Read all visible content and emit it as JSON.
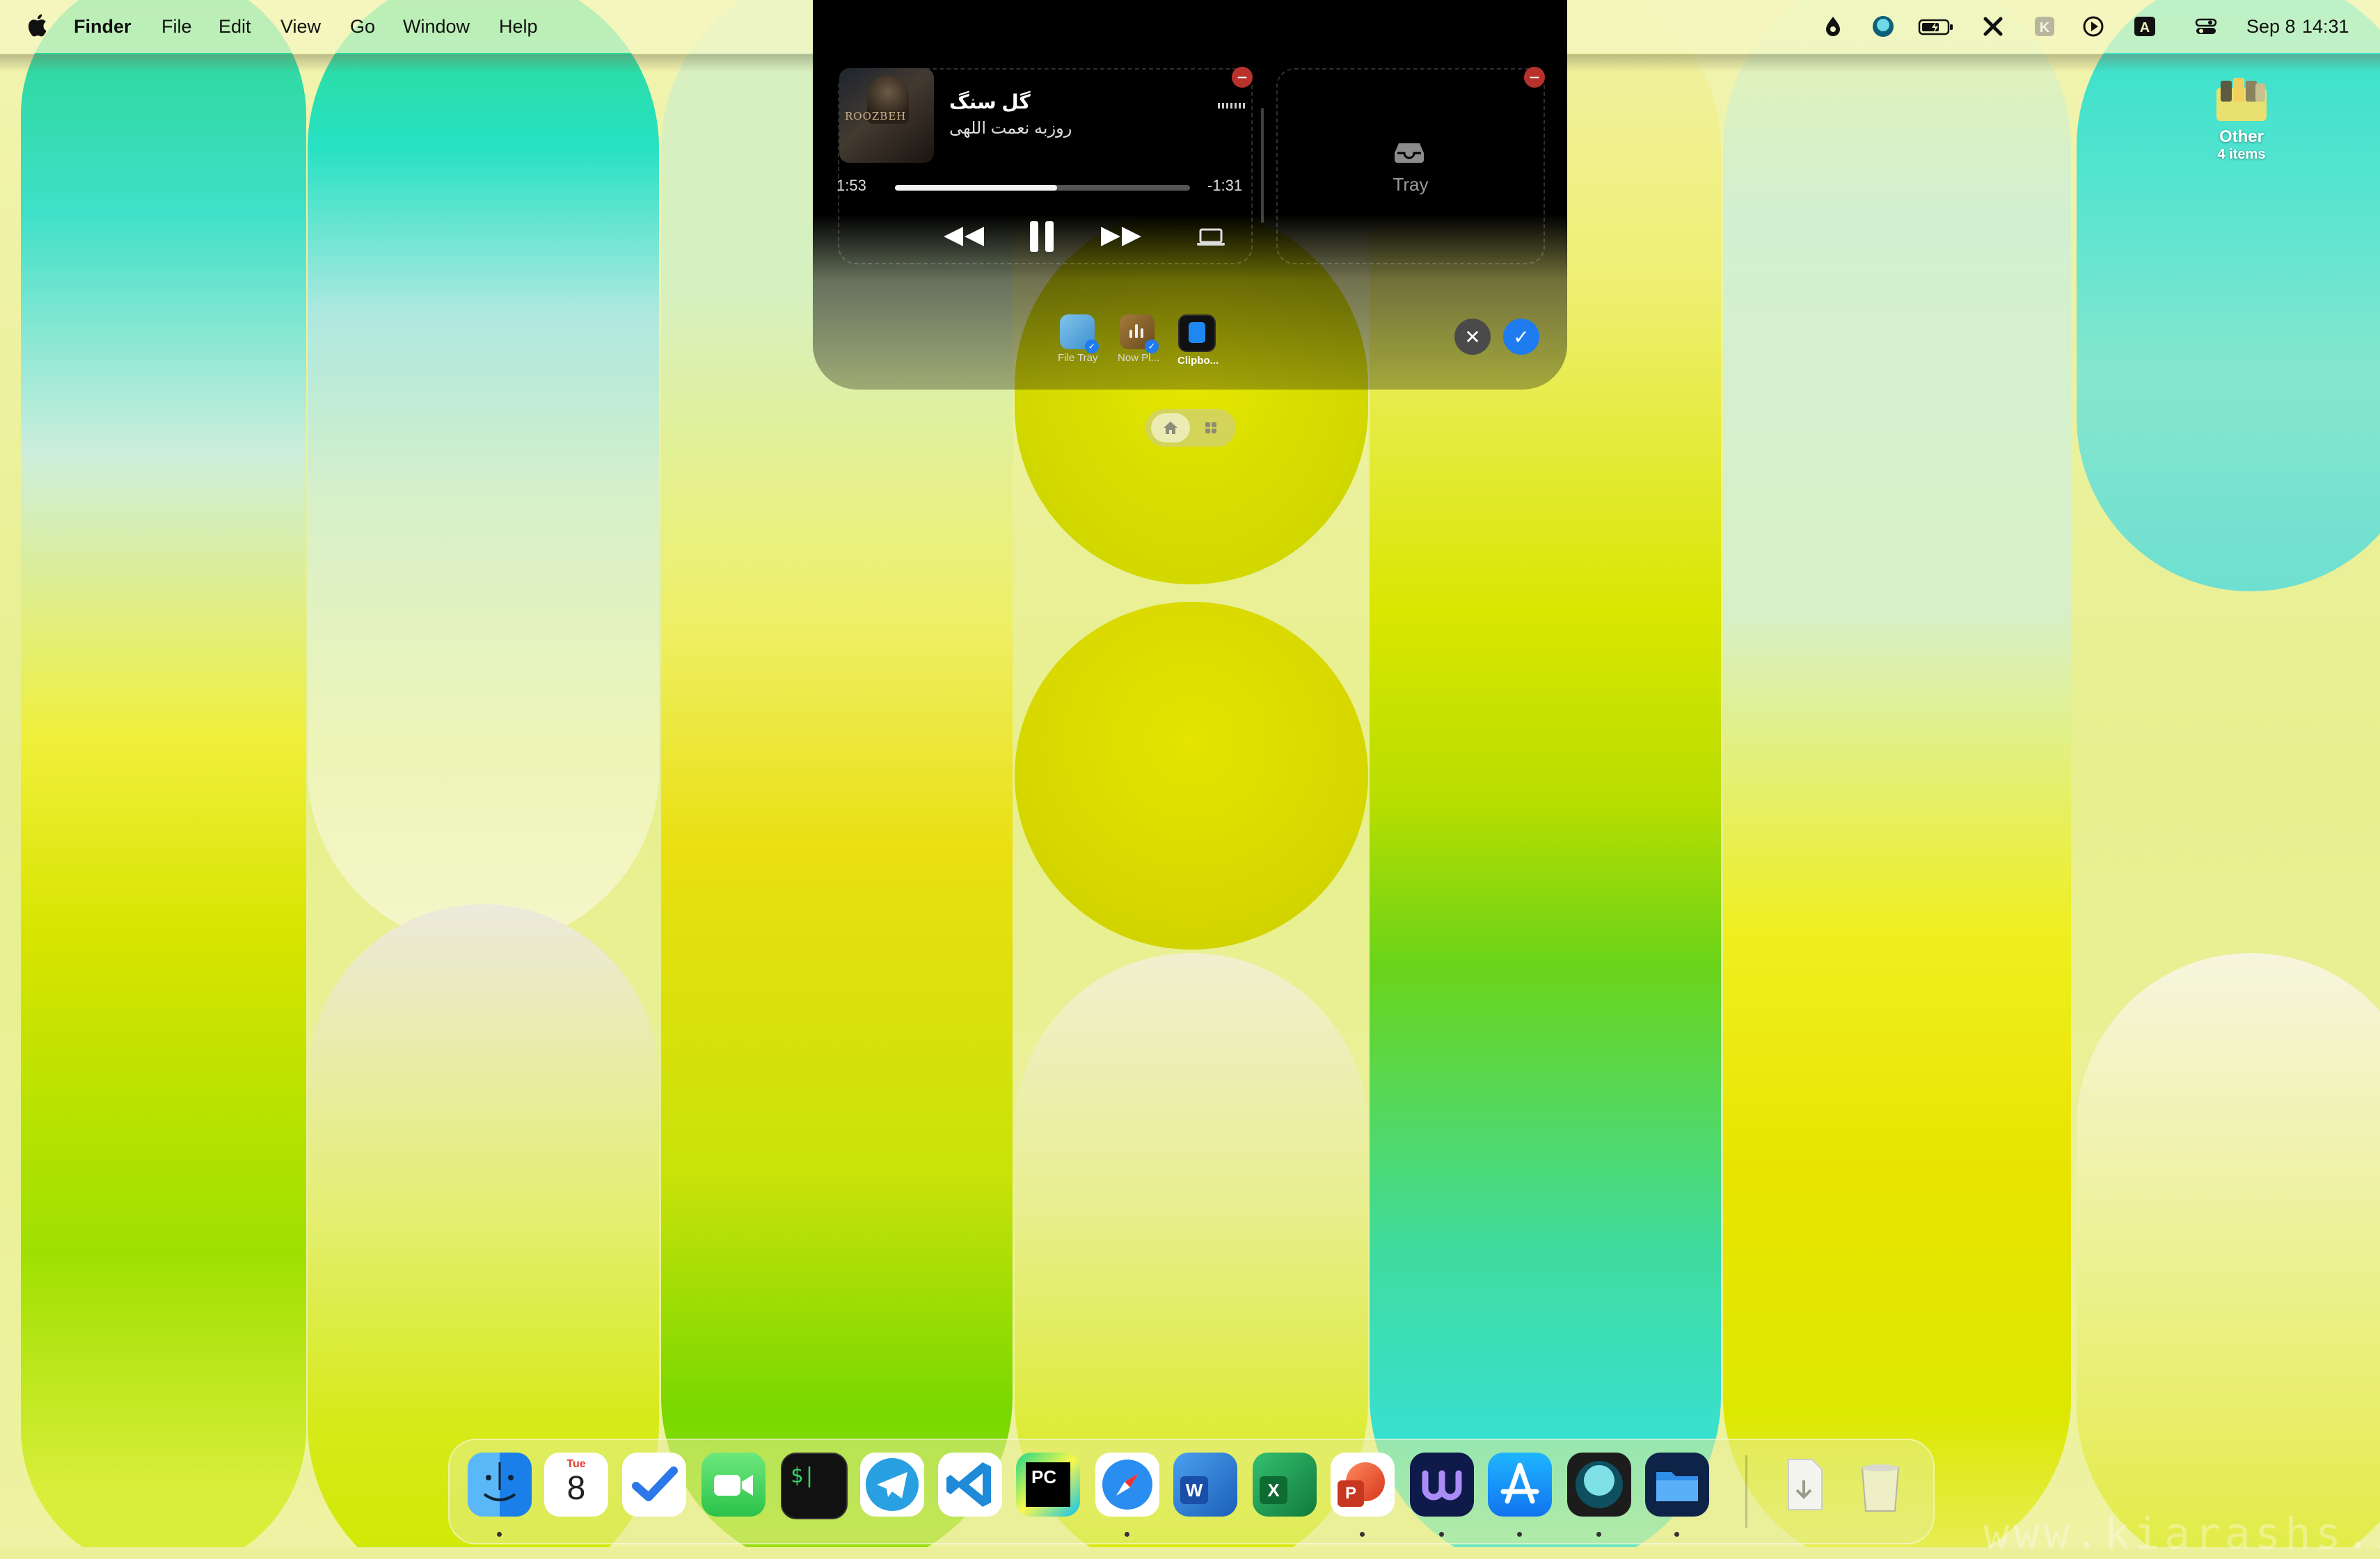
{
  "menubar": {
    "app_name": "Finder",
    "menus": [
      "File",
      "Edit",
      "View",
      "Go",
      "Window",
      "Help"
    ],
    "date": "Sep 8",
    "time": "14:31",
    "status_icons": [
      "drop-icon",
      "circle-app-icon",
      "battery-icon",
      "x-logo-icon",
      "k-icon",
      "play-circle-icon",
      "keyboard-a-icon",
      "control-center-icon"
    ]
  },
  "notch": {
    "music": {
      "title": "گل سنگ",
      "artist": "روزبه نعمت اللهی",
      "elapsed": "1:53",
      "remaining": "-1:31",
      "progress_fraction": 0.55,
      "controls": [
        "rewind-icon",
        "pause-icon",
        "fast-forward-icon",
        "laptop-airplay-icon"
      ]
    },
    "tray": {
      "label": "Tray"
    },
    "widgets": [
      {
        "label": "File Tray",
        "checked": true
      },
      {
        "label": "Now Pl...",
        "checked": true
      },
      {
        "label": "Clipbo...",
        "checked": false
      }
    ],
    "cancel_icon": "close-icon",
    "confirm_icon": "checkmark-icon"
  },
  "segmented": {
    "items": [
      "home-icon",
      "grid-icon"
    ]
  },
  "desktop_stack": {
    "label": "Other",
    "count": "4 items"
  },
  "dock": {
    "apps": [
      "Finder",
      "Calendar",
      "Tasks",
      "FaceTime",
      "Terminal",
      "Telegram",
      "Visual Studio Code",
      "PyCharm",
      "Safari",
      "Word",
      "Excel",
      "PowerPoint",
      "Ulysses",
      "App Store",
      "Lasso",
      "Files",
      "Downloads",
      "Trash"
    ],
    "calendar_day": "Tue",
    "calendar_date": "8",
    "terminal_glyph": "$|",
    "pycharm_glyph": "PC",
    "word_glyph": "W",
    "excel_glyph": "X",
    "powerpoint_glyph": "P"
  },
  "watermark": "www.kiarashs.ir",
  "colors": {
    "accent": "#1e7bf0",
    "remove_badge": "#b8322c",
    "notch_bg": "#000000"
  }
}
